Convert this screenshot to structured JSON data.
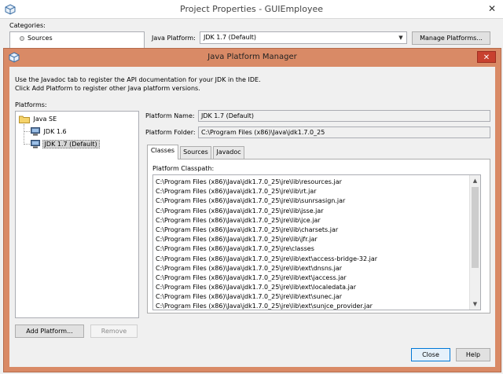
{
  "back_window": {
    "title": "Project Properties - GUIEmployee",
    "close_glyph": "✕",
    "categories_label": "Categories:",
    "category_items": [
      "Sources"
    ],
    "java_platform_label": "Java Platform:",
    "java_platform_value": "JDK 1.7 (Default)",
    "manage_platforms_label": "Manage Platforms..."
  },
  "dialog": {
    "title": "Java Platform Manager",
    "close_glyph": "✕",
    "info_line1": "Use the Javadoc tab to register the API documentation for your JDK in the IDE.",
    "info_line2": "Click Add Platform to register other Java platform versions.",
    "platforms_label": "Platforms:",
    "tree": {
      "root": "Java SE",
      "children": [
        "JDK 1.6",
        "JDK 1.7 (Default)"
      ]
    },
    "platform_name_label": "Platform Name:",
    "platform_name_value": "JDK 1.7 (Default)",
    "platform_folder_label": "Platform Folder:",
    "platform_folder_value": "C:\\Program Files (x86)\\Java\\jdk1.7.0_25",
    "tabs": [
      "Classes",
      "Sources",
      "Javadoc"
    ],
    "active_tab": "Classes",
    "classpath_label": "Platform Classpath:",
    "classpath_items": [
      "C:\\Program Files (x86)\\Java\\jdk1.7.0_25\\jre\\lib\\resources.jar",
      "C:\\Program Files (x86)\\Java\\jdk1.7.0_25\\jre\\lib\\rt.jar",
      "C:\\Program Files (x86)\\Java\\jdk1.7.0_25\\jre\\lib\\sunrsasign.jar",
      "C:\\Program Files (x86)\\Java\\jdk1.7.0_25\\jre\\lib\\jsse.jar",
      "C:\\Program Files (x86)\\Java\\jdk1.7.0_25\\jre\\lib\\jce.jar",
      "C:\\Program Files (x86)\\Java\\jdk1.7.0_25\\jre\\lib\\charsets.jar",
      "C:\\Program Files (x86)\\Java\\jdk1.7.0_25\\jre\\lib\\jfr.jar",
      "C:\\Program Files (x86)\\Java\\jdk1.7.0_25\\jre\\classes",
      "C:\\Program Files (x86)\\Java\\jdk1.7.0_25\\jre\\lib\\ext\\access-bridge-32.jar",
      "C:\\Program Files (x86)\\Java\\jdk1.7.0_25\\jre\\lib\\ext\\dnsns.jar",
      "C:\\Program Files (x86)\\Java\\jdk1.7.0_25\\jre\\lib\\ext\\jaccess.jar",
      "C:\\Program Files (x86)\\Java\\jdk1.7.0_25\\jre\\lib\\ext\\localedata.jar",
      "C:\\Program Files (x86)\\Java\\jdk1.7.0_25\\jre\\lib\\ext\\sunec.jar",
      "C:\\Program Files (x86)\\Java\\jdk1.7.0_25\\jre\\lib\\ext\\sunjce_provider.jar"
    ],
    "add_platform_label": "Add Platform...",
    "remove_label": "Remove",
    "close_label": "Close",
    "help_label": "Help"
  },
  "colors": {
    "dialog_frame": "#d98a66",
    "close_button_red": "#c8412f",
    "focus_blue": "#0078d7"
  },
  "icons": {
    "app": "netbeans-cube-icon",
    "folder": "folder-icon",
    "platform": "jdk-platform-icon",
    "source": "source-node-icon"
  }
}
